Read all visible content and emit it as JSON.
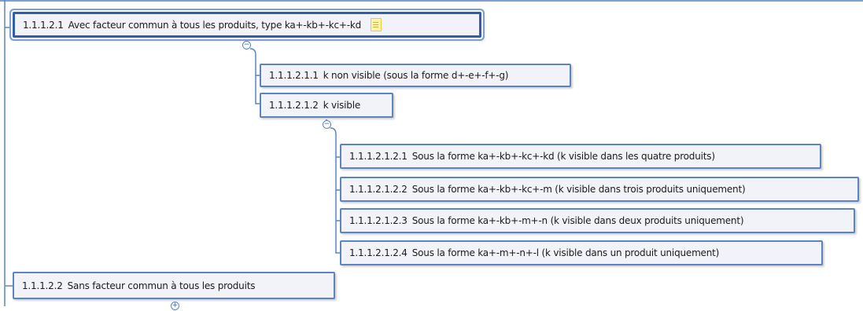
{
  "nodes": {
    "root": {
      "num": "1.1.1.2.1",
      "text": "Avec facteur commun à tous les produits, type ka+-kb+-kc+-kd"
    },
    "k_non_visible": {
      "num": "1.1.1.2.1.1",
      "text": "k non visible (sous la forme d+-e+-f+-g)"
    },
    "k_visible": {
      "num": "1.1.1.2.1.2",
      "text": "k visible"
    },
    "four": {
      "num": "1.1.1.2.1.2.1",
      "text": "Sous la forme  ka+-kb+-kc+-kd (k visible dans les quatre produits)"
    },
    "three": {
      "num": "1.1.1.2.1.2.2",
      "text": "Sous la forme  ka+-kb+-kc+-m (k visible dans trois produits uniquement)"
    },
    "two": {
      "num": "1.1.1.2.1.2.3",
      "text": "Sous la forme ka+-kb+-m+-n (k visible dans deux produits uniquement)"
    },
    "one": {
      "num": "1.1.1.2.1.2.4",
      "text": "Sous la forme ka+-m+-n+-l (k visible dans un produit uniquement)"
    },
    "sans": {
      "num": "1.1.1.2.2",
      "text": "Sans facteur commun à tous les produits"
    }
  },
  "toggles": {
    "collapse": "−",
    "expand": "+"
  },
  "icons": {
    "note": "note-icon"
  },
  "colors": {
    "border": "#5b84c4",
    "selected_border": "#2e5fae",
    "node_fill": "#f1f3f8",
    "wire": "#5b84c4"
  }
}
